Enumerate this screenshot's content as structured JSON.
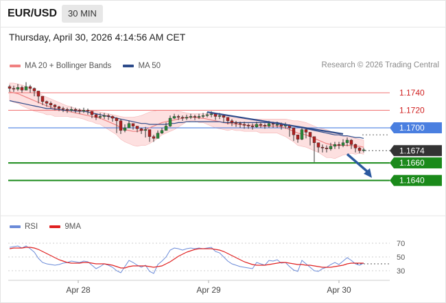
{
  "header": {
    "symbol": "EUR/USD",
    "timeframe": "30 MIN"
  },
  "timestamp": "Thursday, April 30, 2026 4:14:56 AM CET",
  "credit": "Research © 2026 Trading Central",
  "legend": {
    "ma20_label": "MA 20 + Bollinger Bands",
    "ma50_label": "MA 50",
    "rsi_label": "RSI",
    "ma9_label": "9MA"
  },
  "colors": {
    "bollinger_fill": "#fcd6d6",
    "ma20": "#f08080",
    "ma50": "#2c4a8a",
    "resistance": "#f07070",
    "pivot": "#4a7fe0",
    "support": "#1a8a1a",
    "trendline": "#2c4a8a",
    "arrow": "#2c5aa0",
    "price_tag": "#333333",
    "rsi": "#6a8ad8",
    "rsi_ma": "#e02020",
    "candle_up": "#2a8a3a",
    "candle_down": "#b02020"
  },
  "chart_data": [
    {
      "type": "candlestick",
      "title": "EUR/USD 30 MIN",
      "x_tick_labels": [
        "Apr 28",
        "Apr 29",
        "Apr 30"
      ],
      "y_axis_range": [
        1.1628,
        1.1758
      ],
      "levels": [
        {
          "value": 1.174,
          "label": "1.1740",
          "kind": "resistance"
        },
        {
          "value": 1.172,
          "label": "1.1720",
          "kind": "resistance"
        },
        {
          "value": 1.17,
          "label": "1.1700",
          "kind": "pivot"
        },
        {
          "value": 1.1674,
          "label": "1.1674",
          "kind": "last-price"
        },
        {
          "value": 1.166,
          "label": "1.1660",
          "kind": "support"
        },
        {
          "value": 1.164,
          "label": "1.1640",
          "kind": "support"
        }
      ],
      "trendline": {
        "from": [
          48,
          1.1718
        ],
        "to": [
          81,
          1.1693
        ]
      },
      "forecast_arrow": {
        "from": [
          82,
          1.167
        ],
        "to": [
          88,
          1.1643
        ],
        "direction": "down"
      },
      "close": [
        1.1745,
        1.1744,
        1.1746,
        1.1743,
        1.1747,
        1.1745,
        1.1742,
        1.1736,
        1.173,
        1.1728,
        1.1726,
        1.1724,
        1.1722,
        1.1721,
        1.172,
        1.1721,
        1.172,
        1.1719,
        1.172,
        1.1719,
        1.1715,
        1.1712,
        1.1713,
        1.1714,
        1.1713,
        1.1711,
        1.1708,
        1.1697,
        1.17,
        1.1705,
        1.1702,
        1.1699,
        1.1697,
        1.1698,
        1.169,
        1.1688,
        1.1694,
        1.1697,
        1.1702,
        1.1711,
        1.1713,
        1.1712,
        1.1711,
        1.1712,
        1.1713,
        1.1712,
        1.1713,
        1.1714,
        1.1715,
        1.1716,
        1.1713,
        1.1714,
        1.1712,
        1.1708,
        1.1706,
        1.1705,
        1.1704,
        1.1703,
        1.1702,
        1.1701,
        1.1704,
        1.1703,
        1.1702,
        1.1705,
        1.1704,
        1.1704,
        1.1702,
        1.1703,
        1.17,
        1.1692,
        1.1687,
        1.1698,
        1.1695,
        1.169,
        1.1683,
        1.1678,
        1.1677,
        1.1676,
        1.1679,
        1.1681,
        1.168,
        1.1683,
        1.1686,
        1.1681,
        1.1677,
        1.1674,
        1.1675
      ],
      "high": [
        1.1749,
        1.1748,
        1.175,
        1.1748,
        1.1752,
        1.1749,
        1.1746,
        1.174,
        1.1734,
        1.1731,
        1.173,
        1.1727,
        1.1725,
        1.1724,
        1.1723,
        1.1724,
        1.1723,
        1.1722,
        1.1723,
        1.1722,
        1.1719,
        1.1716,
        1.1717,
        1.1717,
        1.1716,
        1.1714,
        1.1712,
        1.171,
        1.1704,
        1.1708,
        1.1705,
        1.1702,
        1.17,
        1.1701,
        1.1698,
        1.1692,
        1.1697,
        1.17,
        1.1706,
        1.1714,
        1.1716,
        1.1715,
        1.1714,
        1.1715,
        1.1716,
        1.1715,
        1.1716,
        1.1717,
        1.1718,
        1.1719,
        1.1717,
        1.1717,
        1.1715,
        1.1712,
        1.171,
        1.1708,
        1.1707,
        1.1707,
        1.1705,
        1.1705,
        1.1707,
        1.1706,
        1.1705,
        1.1708,
        1.1707,
        1.1707,
        1.1706,
        1.1706,
        1.1704,
        1.17,
        1.1692,
        1.1701,
        1.1699,
        1.1695,
        1.1689,
        1.1683,
        1.1681,
        1.168,
        1.1683,
        1.1684,
        1.1684,
        1.1687,
        1.1689,
        1.1687,
        1.1682,
        1.1678,
        1.1677
      ],
      "low": [
        1.1741,
        1.1741,
        1.1742,
        1.174,
        1.1743,
        1.174,
        1.1736,
        1.1728,
        1.1726,
        1.1724,
        1.1722,
        1.172,
        1.1719,
        1.1718,
        1.1717,
        1.1718,
        1.1717,
        1.1716,
        1.1717,
        1.1715,
        1.1711,
        1.1709,
        1.171,
        1.171,
        1.1709,
        1.1707,
        1.1694,
        1.1693,
        1.1695,
        1.17,
        1.1698,
        1.1695,
        1.1693,
        1.1689,
        1.1684,
        1.1684,
        1.1688,
        1.1693,
        1.1698,
        1.1701,
        1.171,
        1.1709,
        1.1708,
        1.1709,
        1.171,
        1.1709,
        1.171,
        1.1711,
        1.1712,
        1.1712,
        1.1709,
        1.171,
        1.1706,
        1.1704,
        1.1702,
        1.1701,
        1.17,
        1.1699,
        1.1699,
        1.1698,
        1.17,
        1.17,
        1.1699,
        1.17,
        1.17,
        1.17,
        1.1698,
        1.1699,
        1.169,
        1.1685,
        1.1683,
        1.1686,
        1.1688,
        1.168,
        1.1661,
        1.1672,
        1.1672,
        1.1672,
        1.1674,
        1.1676,
        1.1676,
        1.1678,
        1.1679,
        1.1676,
        1.1672,
        1.1671,
        1.1672
      ],
      "ma20": [
        1.1741,
        1.174,
        1.1739,
        1.1737,
        1.1735,
        1.1733,
        1.1731,
        1.1729,
        1.1727,
        1.1725,
        1.1724,
        1.1722,
        1.1721,
        1.172,
        1.1719,
        1.1718,
        1.1717,
        1.1716,
        1.1715,
        1.1714,
        1.1713,
        1.1712,
        1.1711,
        1.1709,
        1.1707,
        1.1705,
        1.1703,
        1.17,
        1.1698,
        1.1697,
        1.1696,
        1.1696,
        1.1697,
        1.1698,
        1.17,
        1.1702,
        1.1704,
        1.1706,
        1.1707,
        1.1708,
        1.1709,
        1.171,
        1.1711,
        1.1712,
        1.1712,
        1.1712,
        1.1711,
        1.1711,
        1.171,
        1.1709,
        1.1708,
        1.1707,
        1.1706,
        1.1705,
        1.1705,
        1.1704,
        1.1704,
        1.1703,
        1.1703,
        1.1703,
        1.1703,
        1.1702,
        1.1702,
        1.1702,
        1.1702,
        1.1702,
        1.1701,
        1.17,
        1.1698,
        1.1696,
        1.1694,
        1.1693,
        1.1692,
        1.169,
        1.1688,
        1.1686,
        1.1684,
        1.1682,
        1.1681,
        1.168,
        1.168,
        1.168,
        1.168,
        1.168,
        1.1679,
        1.1679,
        1.1678
      ],
      "bollinger_upper": [
        1.1751,
        1.1751,
        1.175,
        1.1749,
        1.1747,
        1.1745,
        1.1743,
        1.174,
        1.1737,
        1.1735,
        1.1733,
        1.1731,
        1.1729,
        1.1727,
        1.1725,
        1.1724,
        1.1722,
        1.1721,
        1.172,
        1.172,
        1.1719,
        1.1719,
        1.1718,
        1.1717,
        1.1716,
        1.1715,
        1.1714,
        1.1713,
        1.1712,
        1.1712,
        1.1712,
        1.1713,
        1.1714,
        1.1716,
        1.1718,
        1.1719,
        1.172,
        1.172,
        1.172,
        1.172,
        1.172,
        1.1719,
        1.1718,
        1.1717,
        1.1716,
        1.1716,
        1.1716,
        1.1716,
        1.1716,
        1.1716,
        1.1716,
        1.1715,
        1.1714,
        1.1713,
        1.1712,
        1.1711,
        1.1711,
        1.171,
        1.171,
        1.171,
        1.171,
        1.171,
        1.171,
        1.171,
        1.171,
        1.171,
        1.171,
        1.171,
        1.1709,
        1.1708,
        1.1708,
        1.1707,
        1.1706,
        1.1704,
        1.1702,
        1.17,
        1.1699,
        1.1698,
        1.1696,
        1.1695,
        1.1693,
        1.1691,
        1.169,
        1.1689,
        1.1688,
        1.1687,
        1.1686
      ],
      "bollinger_lower": [
        1.1731,
        1.1729,
        1.1728,
        1.1725,
        1.1723,
        1.1721,
        1.1719,
        1.1718,
        1.1717,
        1.1715,
        1.1715,
        1.1713,
        1.1713,
        1.1713,
        1.1713,
        1.1712,
        1.1712,
        1.1711,
        1.171,
        1.1708,
        1.1707,
        1.1705,
        1.1704,
        1.1701,
        1.1698,
        1.1695,
        1.1692,
        1.1687,
        1.1684,
        1.1682,
        1.168,
        1.1679,
        1.168,
        1.168,
        1.1682,
        1.1685,
        1.1688,
        1.1692,
        1.1694,
        1.1696,
        1.1698,
        1.1701,
        1.1704,
        1.1707,
        1.1708,
        1.1708,
        1.1706,
        1.1706,
        1.1704,
        1.1702,
        1.17,
        1.1699,
        1.1698,
        1.1697,
        1.1698,
        1.1697,
        1.1697,
        1.1696,
        1.1696,
        1.1696,
        1.1696,
        1.1694,
        1.1694,
        1.1694,
        1.1694,
        1.1694,
        1.1692,
        1.169,
        1.1687,
        1.1684,
        1.168,
        1.1679,
        1.1678,
        1.1676,
        1.1674,
        1.1672,
        1.1669,
        1.1666,
        1.1666,
        1.1665,
        1.1667,
        1.1669,
        1.167,
        1.1671,
        1.167,
        1.1671,
        1.167
      ],
      "ma50": [
        1.1731,
        1.173,
        1.1729,
        1.1728,
        1.1727,
        1.1726,
        1.1725,
        1.1724,
        1.1723,
        1.1722,
        1.1722,
        1.1721,
        1.1721,
        1.172,
        1.172,
        1.172,
        1.1719,
        1.1719,
        1.1719,
        1.1718,
        1.1717,
        1.1716,
        1.1715,
        1.1714,
        1.1713,
        1.1712,
        1.1711,
        1.171,
        1.1709,
        1.1708,
        1.1707,
        1.1706,
        1.1705,
        1.1705,
        1.1704,
        1.1704,
        1.1704,
        1.1704,
        1.1704,
        1.1705,
        1.1705,
        1.1706,
        1.1706,
        1.1707,
        1.1707,
        1.1707,
        1.1707,
        1.1707,
        1.1707,
        1.1707,
        1.1707,
        1.1707,
        1.1706,
        1.1706,
        1.1706,
        1.1706,
        1.1706,
        1.1706,
        1.1706,
        1.1706,
        1.1706,
        1.1706,
        1.1706,
        1.1706,
        1.1706,
        1.1706,
        1.1705,
        1.1704,
        1.1703,
        1.1702,
        1.1701,
        1.17,
        1.1699,
        1.1698,
        1.1697,
        1.1696,
        1.1695,
        1.1694,
        1.1693,
        1.1692,
        1.1692,
        1.1691,
        1.1691,
        1.169,
        1.1689,
        1.1689,
        1.1688
      ]
    },
    {
      "type": "line",
      "title": "RSI",
      "y_tick_labels": [
        "70",
        "50",
        "30"
      ],
      "y_axis_range": [
        22,
        78
      ],
      "reference_levels": [
        70,
        50,
        30
      ],
      "dotted_line": 40,
      "series": [
        {
          "name": "RSI",
          "values": [
            64,
            65,
            66,
            63,
            66,
            62,
            57,
            48,
            42,
            40,
            39,
            38,
            39,
            41,
            42,
            44,
            43,
            42,
            44,
            43,
            38,
            33,
            36,
            40,
            38,
            35,
            30,
            27,
            36,
            45,
            42,
            38,
            35,
            38,
            29,
            26,
            39,
            44,
            50,
            60,
            63,
            62,
            60,
            62,
            63,
            62,
            63,
            62,
            63,
            64,
            58,
            56,
            50,
            44,
            40,
            38,
            36,
            35,
            34,
            33,
            42,
            40,
            38,
            45,
            44,
            46,
            41,
            42,
            36,
            31,
            29,
            45,
            40,
            35,
            30,
            29,
            33,
            35,
            39,
            42,
            39,
            44,
            49,
            45,
            40,
            38,
            41
          ]
        },
        {
          "name": "9MA",
          "values": [
            62,
            63,
            63,
            63,
            64,
            64,
            63,
            61,
            58,
            55,
            52,
            49,
            46,
            44,
            42,
            41,
            41,
            41,
            42,
            42,
            41,
            40,
            40,
            40,
            39,
            38,
            36,
            34,
            34,
            36,
            37,
            37,
            37,
            37,
            36,
            35,
            36,
            37,
            40,
            43,
            47,
            51,
            54,
            57,
            59,
            61,
            62,
            62,
            62,
            62,
            61,
            60,
            58,
            55,
            52,
            49,
            46,
            43,
            41,
            39,
            38,
            38,
            38,
            39,
            40,
            41,
            42,
            42,
            41,
            40,
            39,
            39,
            38,
            38,
            37,
            36,
            35,
            35,
            35,
            36,
            37,
            38,
            40,
            41,
            41,
            41,
            41
          ]
        }
      ]
    }
  ]
}
